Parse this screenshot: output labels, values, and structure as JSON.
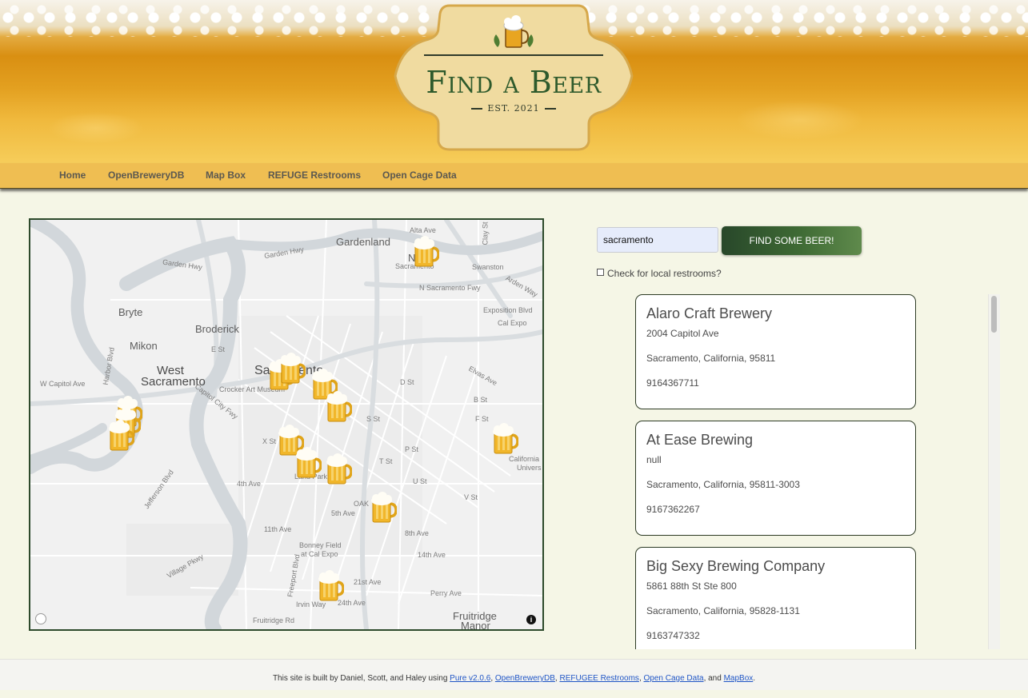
{
  "logo": {
    "title": "Find a Beer",
    "est": "EST. 2021"
  },
  "nav": {
    "items": [
      {
        "label": "Home"
      },
      {
        "label": "OpenBreweryDB"
      },
      {
        "label": "Map Box"
      },
      {
        "label": "REFUGE Restrooms"
      },
      {
        "label": "Open Cage Data"
      }
    ]
  },
  "map": {
    "labels": {
      "gardenland": "Gardenland",
      "alta": "Alta Ave",
      "clay": "Clay St",
      "gardenhwy1": "Garden Hwy",
      "gardenhwy2": "Garden Hwy",
      "north_sac": "North",
      "sacramento_n": "Sacramento",
      "swanston": "Swanston",
      "n_sac_fwy": "N Sacramento Fwy",
      "arden": "Arden Way",
      "exposition": "Exposition Blvd",
      "cal_expo": "Cal Expo",
      "bryte": "Bryte",
      "broderick": "Broderick",
      "mikon": "Mikon",
      "west_sac1": "West",
      "west_sac2": "Sacramento",
      "sacramento": "Sacramento",
      "crocker": "Crocker Art Museum",
      "capitol_city": "Capitol City Fwy",
      "w_capitol": "W Capitol Ave",
      "harbor": "Harbor Blvd",
      "elvas": "Elvas Ave",
      "x_st": "X St",
      "t_st": "T St",
      "u_st": "U St",
      "v_st": "V St",
      "jefferson": "Jefferson Blvd",
      "fourth_ave": "4th Ave",
      "fifth_ave": "5th Ave",
      "eighth_ave": "8th Ave",
      "eleventh_ave": "11th Ave",
      "fourteenth_ave": "14th Ave",
      "bonney": "Bonney Field",
      "bonney2": "at Cal Expo",
      "village": "Village Pkwy",
      "freeport": "Freeport Blvd",
      "irvin": "Irvin Way",
      "twentyfirst": "21st Ave",
      "twentyfourth": "24th Ave",
      "fruitridge_rd": "Fruitridge Rd",
      "fruitridge": "Fruitridge",
      "manor": "Manor",
      "california": "California",
      "univers": "Univers",
      "oak": "OAK",
      "land_park": "Land Park",
      "perry": "Perry Ave",
      "e_st": "E St",
      "p_st": "P St",
      "b_st": "B St",
      "f_st": "F St",
      "d_st": "D St",
      "s_st": "S St"
    }
  },
  "search": {
    "value": "sacramento",
    "button_label": "FIND SOME BEER!",
    "restroom_label": "Check for local restrooms?"
  },
  "results": [
    {
      "name": "Alaro Craft Brewery",
      "street": "2004 Capitol Ave",
      "city": "Sacramento, California, 95811",
      "phone": "9164367711"
    },
    {
      "name": "At Ease Brewing",
      "street": "null",
      "city": "Sacramento, California, 95811-3003",
      "phone": "9167362267"
    },
    {
      "name": "Big Sexy Brewing Company",
      "street": "5861 88th St Ste 800",
      "city": "Sacramento, California, 95828-1131",
      "phone": "9163747332"
    }
  ],
  "footer": {
    "prefix": "This site is built by Daniel, Scott, and Haley using ",
    "links": [
      "Pure v2.0.6",
      "OpenBreweryDB",
      "REFUGEE Restrooms",
      "Open Cage Data",
      "MapBox"
    ],
    "sep1": ", ",
    "sep2": ", ",
    "sep3": ", ",
    "sep4": ", and ",
    "suffix": "."
  },
  "colors": {
    "accent_green": "#2e5a2c",
    "nav_gold": "#efbe52",
    "link_blue": "#1f55c6"
  },
  "icons": {
    "marker": "beer-mug-icon",
    "info": "info-icon"
  }
}
